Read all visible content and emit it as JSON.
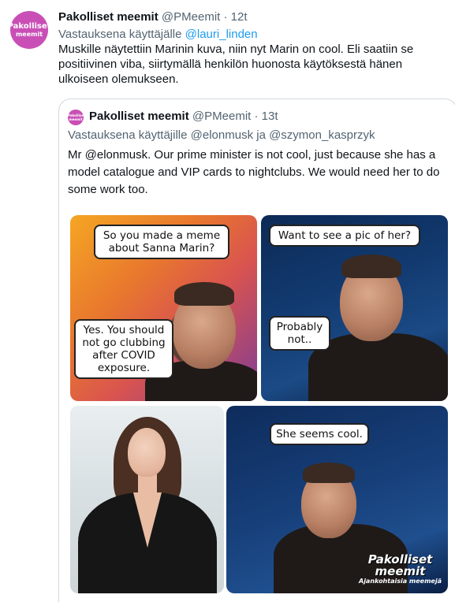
{
  "tweet": {
    "avatar_text_1": "Pakolliset",
    "avatar_text_2": "meemit",
    "name": "Pakolliset meemit",
    "handle": "@PMeemit",
    "separator": "·",
    "time": "12t",
    "replying_prefix": "Vastauksena käyttäjälle",
    "replying_user": "@lauri_linden",
    "text": "Muskille näytettiin Marinin kuva, niin nyt Marin on cool. Eli saatiin se positiivinen viba, siirtymällä henkilön huonosta käytöksestä hänen ulkoiseen olemukseen."
  },
  "quoted": {
    "avatar_text": "Pakolliset meemit",
    "name": "Pakolliset meemit",
    "handle": "@PMeemit",
    "separator": "·",
    "time": "13t",
    "replying": "Vastauksena käyttäjille @elonmusk ja @szymon_kasprzyk",
    "text": "Mr @elonmusk. Our prime minister is not cool, just because she has a model catalogue and VIP cards to nightclubs. We would need her to do some work too."
  },
  "meme": {
    "bubble_1": "So you made a meme about Sanna Marin?",
    "bubble_2": "Yes. You should not go clubbing after COVID exposure.",
    "bubble_3": "Want to see a pic of her?",
    "bubble_4": "Probably not..",
    "bubble_5": "She seems cool.",
    "logo_1": "Pakolliset",
    "logo_2": "meemit",
    "logo_3": "Ajankohtaisia meemejä"
  },
  "colors": {
    "brand": "#c94fb6",
    "link": "#1d9bf0",
    "muted": "#536471",
    "border": "#cfd9de"
  }
}
